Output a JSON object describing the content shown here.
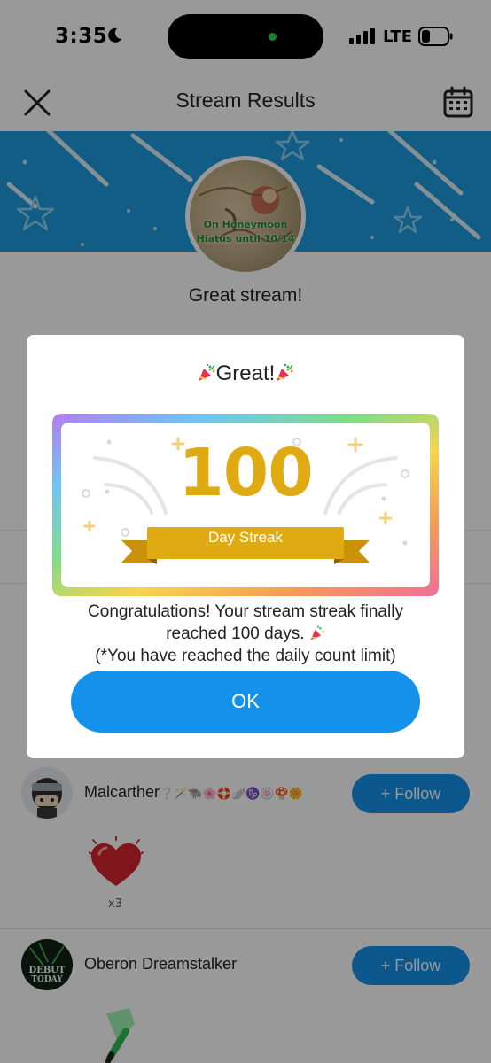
{
  "status_bar": {
    "time": "3:35",
    "network": "LTE"
  },
  "header": {
    "title": "Stream Results"
  },
  "profile": {
    "avatar_line1": "On Honeymoon",
    "avatar_line2": "Hiatus until 10/14",
    "message": "Great stream!"
  },
  "viewers": [
    {
      "name": "Malcarther",
      "name_suffix": "❔🪄🐃🌸🛟🪽♑🍥🍄🌼",
      "follow_label": "+ Follow"
    },
    {
      "name": "Oberon Dreamstalker",
      "name_suffix": "",
      "follow_label": "+ Follow"
    }
  ],
  "gift": {
    "count": "x3"
  },
  "modal": {
    "title": "Great!",
    "streak_number": "100",
    "streak_label": "Day Streak",
    "message_line1": "Congratulations! Your stream streak finally",
    "message_line2": "reached 100 days.",
    "message_line3": "(*You have reached the daily count limit)",
    "ok_label": "OK"
  },
  "avatar_text": {
    "debut": "DEBUT",
    "today": "TODAY"
  },
  "colors": {
    "accent": "#1492ea",
    "banner": "#1e9ce0",
    "gold": "#e0aa12"
  }
}
